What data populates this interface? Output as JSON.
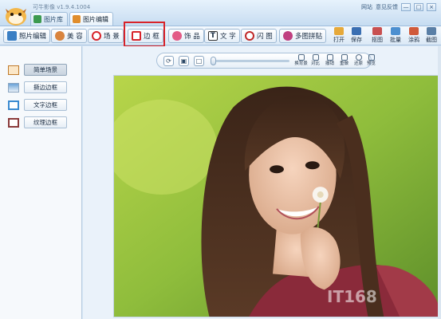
{
  "app": {
    "title": "可牛影像 v1.9.4.1004",
    "links": [
      "网站",
      "意见反馈"
    ],
    "window_buttons": [
      "—",
      "□",
      "×"
    ]
  },
  "tabs": [
    {
      "label": "图片库",
      "active": false
    },
    {
      "label": "图片编辑",
      "active": true
    }
  ],
  "toolbar": {
    "items": [
      {
        "label": "照片编辑",
        "icon": "photo-edit-icon"
      },
      {
        "label": "美 容",
        "icon": "beauty-face-icon"
      },
      {
        "label": "场 景",
        "icon": "scene-icon"
      },
      {
        "label": "边 框",
        "icon": "frame-icon"
      },
      {
        "label": "饰 品",
        "icon": "bow-icon"
      },
      {
        "label": "文 字",
        "icon": "text-icon"
      },
      {
        "label": "闪 图",
        "icon": "flash-icon"
      },
      {
        "label": "多图拼贴",
        "icon": "collage-icon"
      }
    ],
    "right_items": [
      {
        "label": "打开",
        "icon": "open-icon"
      },
      {
        "label": "保存",
        "icon": "save-icon"
      },
      {
        "label": "抠图",
        "icon": "cutout-icon"
      },
      {
        "label": "批量",
        "icon": "batch-icon"
      },
      {
        "label": "涂鸦",
        "icon": "doodle-icon"
      },
      {
        "label": "截图",
        "icon": "screenshot-icon"
      }
    ]
  },
  "left_panel": {
    "items": [
      {
        "label": "简单场景",
        "selected": true
      },
      {
        "label": "撕边边框",
        "selected": false
      },
      {
        "label": "文字边框",
        "selected": false
      },
      {
        "label": "纹理边框",
        "selected": false
      }
    ]
  },
  "image_toolbar": {
    "buttons": [
      "rotate-icon",
      "fit-screen-icon",
      "actual-size-icon"
    ],
    "zoom_level": 0.0,
    "actions": [
      {
        "label": "换背景"
      },
      {
        "label": "对比"
      },
      {
        "label": "撤销"
      },
      {
        "label": "重做"
      },
      {
        "label": "还原"
      },
      {
        "label": "预览"
      }
    ]
  },
  "watermark": "IT168",
  "colors": {
    "highlight": "#d8232a",
    "accent": "#3d6fa5"
  }
}
